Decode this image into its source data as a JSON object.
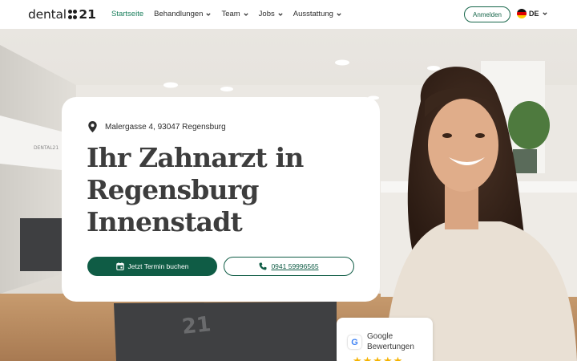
{
  "header": {
    "logo": {
      "text": "dental",
      "number": "21"
    },
    "nav": [
      {
        "label": "Startseite",
        "active": true,
        "dropdown": false
      },
      {
        "label": "Behandlungen",
        "active": false,
        "dropdown": true
      },
      {
        "label": "Team",
        "active": false,
        "dropdown": true
      },
      {
        "label": "Jobs",
        "active": false,
        "dropdown": true
      },
      {
        "label": "Ausstattung",
        "active": false,
        "dropdown": true
      }
    ],
    "login_label": "Anmelden",
    "language": "DE"
  },
  "hero": {
    "address": "Malergasse 4, 93047 Regensburg",
    "headline": [
      "Ihr Zahnarzt in",
      "Regensburg",
      "Innenstadt"
    ],
    "cta_label": "Jetzt Termin buchen",
    "phone": "0941 59996565",
    "wall_sign": "DENTAL21",
    "mat_number": "21"
  },
  "google_reviews": {
    "line1": "Google",
    "line2": "Bewertungen",
    "stars": "★★★★★"
  },
  "colors": {
    "brand_green": "#0f5c45",
    "active_nav": "#1a7f5c",
    "star": "#f5b301"
  }
}
